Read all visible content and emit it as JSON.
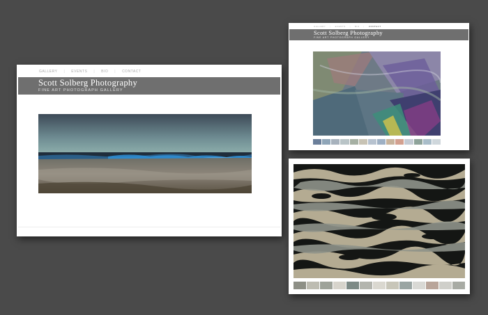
{
  "site": {
    "title": "Scott Solberg Photography",
    "subtitle": "FINE ART PHOTOGRAPH GALLERY"
  },
  "nav": [
    "Gallery",
    "Events",
    "Bio",
    "Contact"
  ],
  "thumbnails_top_right": [
    "#6b7f9a",
    "#8fa5b8",
    "#a7b2bd",
    "#b9c4c7",
    "#a6b0a3",
    "#c8c3b4",
    "#b7c2cf",
    "#9eb0c4",
    "#c7b39c",
    "#d3a08f",
    "#c4cbd4",
    "#8ea39a",
    "#a9bdc9",
    "#cfd7dc"
  ],
  "thumbnails_bottom_right": [
    "#8d8f86",
    "#bdbcb2",
    "#9ea39a",
    "#d7d4cc",
    "#7d8a86",
    "#b3b5ae",
    "#dad8d0",
    "#c8c6b9",
    "#9aa5a3",
    "#d9d9d5",
    "#b9a59a",
    "#cfcfca",
    "#a8aba4"
  ]
}
